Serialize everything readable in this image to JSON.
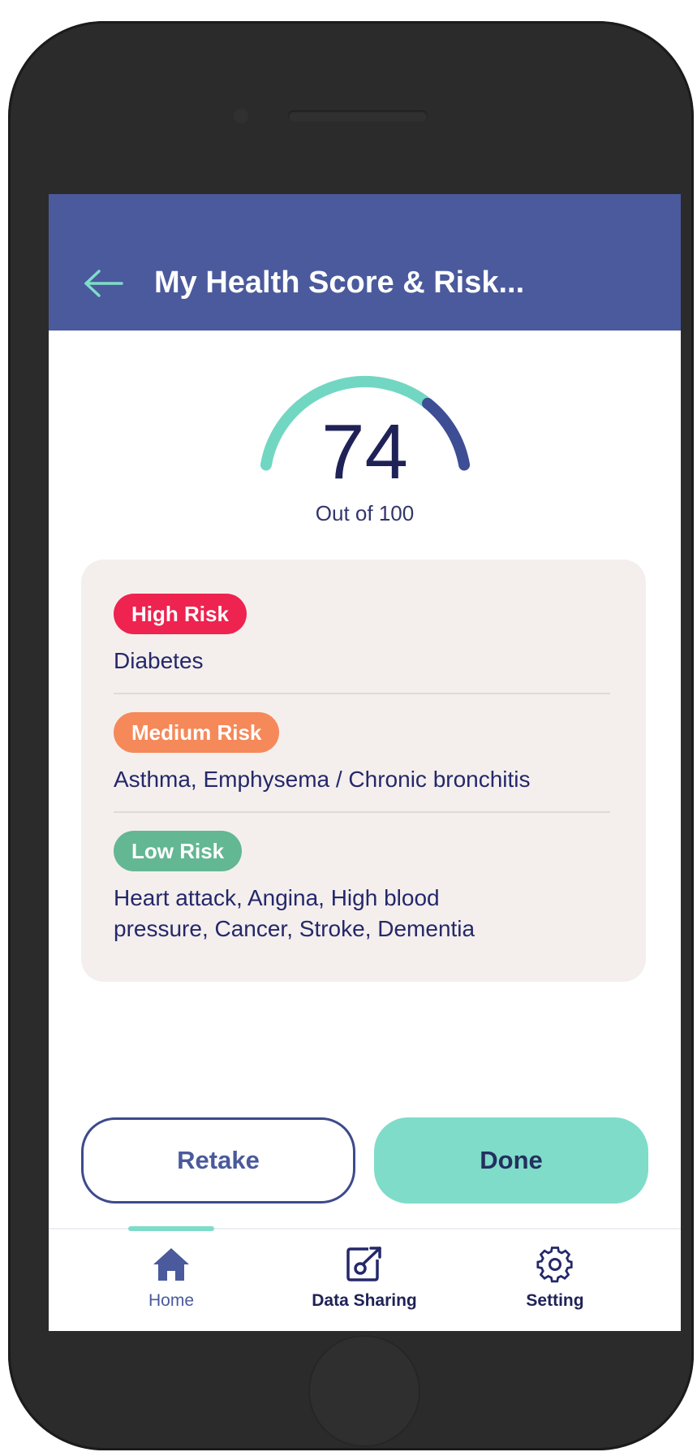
{
  "header": {
    "title": "My Health Score & Risk..."
  },
  "score": {
    "value": "74",
    "caption": "Out of 100",
    "fraction": 0.74,
    "colors": {
      "filled": "#72d7c2",
      "remaining": "#3d4e95"
    }
  },
  "risks": [
    {
      "level": "High Risk",
      "color": "#ee2350",
      "conditions": "Diabetes"
    },
    {
      "level": "Medium Risk",
      "color": "#f5895a",
      "conditions": "Asthma, Emphysema / Chronic bronchitis"
    },
    {
      "level": "Low Risk",
      "color": "#63b792",
      "conditions": "Heart attack, Angina, High blood pressure, Cancer, Stroke, Dementia"
    }
  ],
  "actions": {
    "retake_label": "Retake",
    "done_label": "Done"
  },
  "nav": {
    "items": [
      {
        "label": "Home",
        "icon": "home-icon",
        "active": true
      },
      {
        "label": "Data Sharing",
        "icon": "share-icon",
        "active": false
      },
      {
        "label": "Setting",
        "icon": "gear-icon",
        "active": false
      }
    ]
  },
  "colors": {
    "header_bg": "#4a5a9c",
    "accent": "#7fdcc9",
    "text_dark": "#1f2256"
  }
}
